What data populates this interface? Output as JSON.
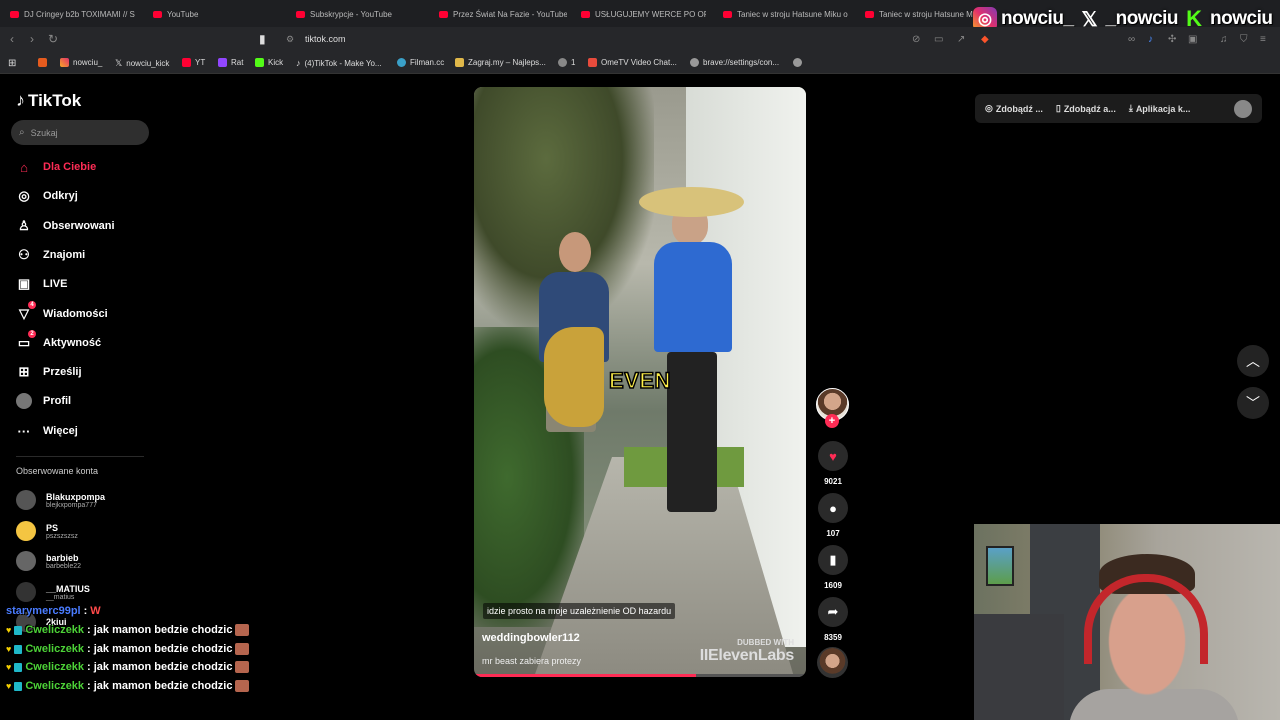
{
  "browser": {
    "tabs": [
      {
        "label": "DJ Cringey b2b TOXIMAMI // S"
      },
      {
        "label": "YouTube"
      },
      {
        "label": "Subskrypcje - YouTube"
      },
      {
        "label": "Przez Świat Na Fazie - YouTube"
      },
      {
        "label": "USŁUGUJEMY WERCE PO OPE"
      },
      {
        "label": "Taniec w stroju Hatsune Miku o"
      },
      {
        "label": "Taniec w stroju Hatsune M"
      }
    ],
    "url": "tiktok.com",
    "bookmarks": [
      {
        "label": "nowciu_"
      },
      {
        "label": "nowciu_kick"
      },
      {
        "label": "YT"
      },
      {
        "label": "Rat"
      },
      {
        "label": "Kick"
      },
      {
        "label": "(4)TikTok - Make Yo..."
      },
      {
        "label": "Filman.cc"
      },
      {
        "label": "Zagraj.my – Najleps..."
      },
      {
        "label": "1"
      },
      {
        "label": "OmeTV Video Chat..."
      },
      {
        "label": "brave://settings/con..."
      }
    ]
  },
  "overlay": {
    "instagram": "nowciu_",
    "x": "_nowciu",
    "kick": "nowciu"
  },
  "sidebar": {
    "logo": "TikTok",
    "search_placeholder": "Szukaj",
    "items": [
      {
        "label": "Dla Ciebie",
        "icon": "home-icon"
      },
      {
        "label": "Odkryj",
        "icon": "compass-icon"
      },
      {
        "label": "Obserwowani",
        "icon": "following-icon"
      },
      {
        "label": "Znajomi",
        "icon": "friends-icon"
      },
      {
        "label": "LIVE",
        "icon": "live-icon"
      },
      {
        "label": "Wiadomości",
        "icon": "messages-icon",
        "badge": "4"
      },
      {
        "label": "Aktywność",
        "icon": "activity-icon",
        "badge": "2"
      },
      {
        "label": "Prześlij",
        "icon": "upload-icon"
      },
      {
        "label": "Profil",
        "icon": "profile-icon"
      },
      {
        "label": "Więcej",
        "icon": "more-icon"
      }
    ],
    "followed_label": "Obserwowane konta",
    "accounts": [
      {
        "name": "Blakuxpompa",
        "handle": "blejkxpompa777"
      },
      {
        "name": "PS",
        "handle": "pszszszsz"
      },
      {
        "name": "barbieb",
        "handle": "barbeble22"
      },
      {
        "name": "__MATIUS",
        "handle": "__matius"
      },
      {
        "name": "2kiui",
        "handle": ""
      }
    ]
  },
  "chat": {
    "first_user": "starymerc99pl",
    "first_msg": "W",
    "lines": [
      {
        "user": "Cweliczekk",
        "msg": "jak mamon bedzie chodzic"
      },
      {
        "user": "Cweliczekk",
        "msg": "jak mamon bedzie chodzic"
      },
      {
        "user": "Cweliczekk",
        "msg": "jak mamon bedzie chodzic"
      },
      {
        "user": "Cweliczekk",
        "msg": "jak mamon bedzie chodzic"
      }
    ]
  },
  "video": {
    "caption_big": "EVEN",
    "subtitle": "idzie prosto na moje uzależnienie OD hazardu",
    "author": "weddingbowler112",
    "description": "mr beast zabiera protezy",
    "dubbed_line1": "DUBBED WITH",
    "dubbed_line2": "IIElevenLabs",
    "progress": 0.67
  },
  "actions": {
    "likes": "9021",
    "comments": "107",
    "saves": "1609",
    "shares": "8359"
  },
  "topbar": {
    "btn1": "Zdobądź ...",
    "btn2": "Zdobądź a...",
    "btn3": "Aplikacja k..."
  }
}
